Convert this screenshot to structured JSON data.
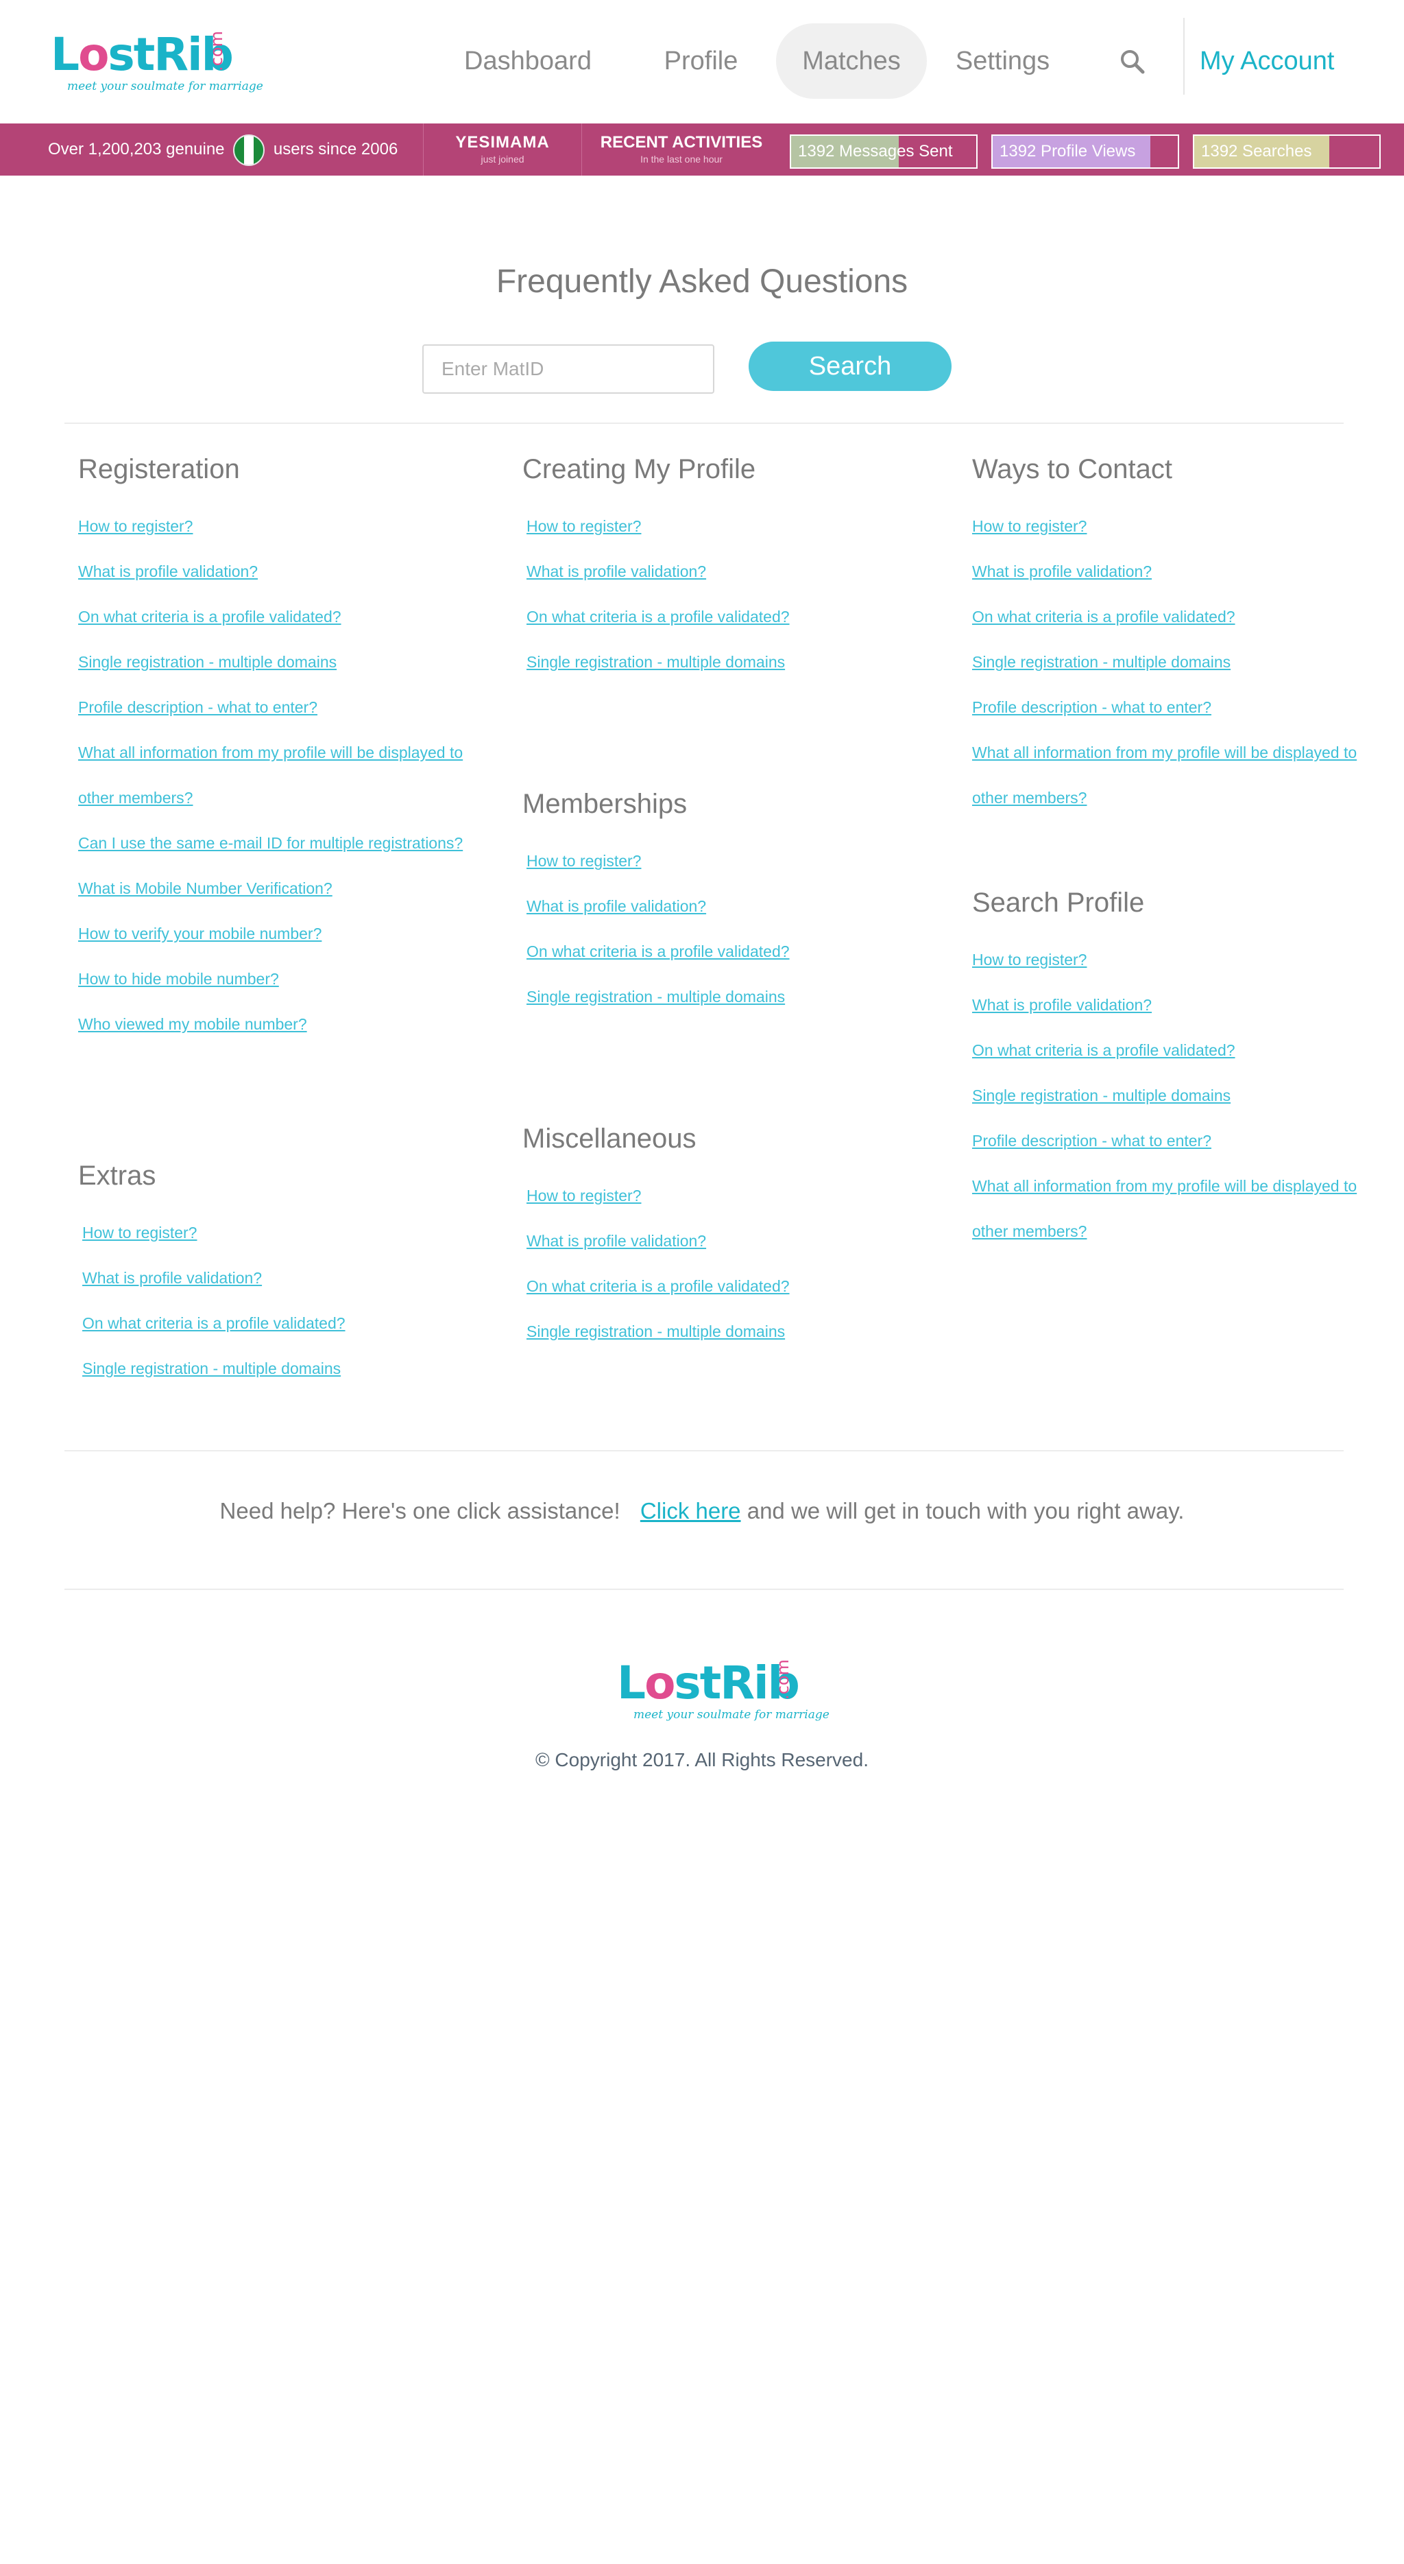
{
  "brand": {
    "name_a": "L",
    "name_ring": "o",
    "name_b": "stRib",
    "domain": ".com",
    "tagline": "meet your soulmate for marriage"
  },
  "nav": {
    "dashboard": "Dashboard",
    "profile": "Profile",
    "matches": "Matches",
    "settings": "Settings",
    "search_icon": "search-icon",
    "account": "My Account"
  },
  "stats": {
    "users_prefix": "Over 1,200,203 genuine",
    "users_suffix": "users since 2006",
    "joined_name": "YESIMAMA",
    "joined_sub": "just joined",
    "recent_title": "RECENT ACTIVITIES",
    "recent_sub": "In the last one hour",
    "messages": {
      "label": "1392 Messages Sent",
      "fill_fraction": 0.58,
      "color": "#b5c4a3"
    },
    "views": {
      "label": "1392 Profile Views",
      "fill_fraction": 0.85,
      "color": "#c7a1e0"
    },
    "searches": {
      "label": "1392 Searches",
      "fill_fraction": 0.73,
      "color": "#d7d3a0"
    }
  },
  "faq": {
    "title": "Frequently Asked Questions",
    "matid_placeholder": "Enter MatID",
    "search_button": "Search",
    "registration": {
      "title": "Registeration",
      "links": [
        "How to register?",
        "What is profile validation?",
        "On what criteria is a profile validated?",
        "Single registration - multiple domains",
        "Profile description - what to enter?",
        "What all information from my profile will be displayed to other members?",
        "Can I use the same e-mail ID for multiple registrations?",
        "What is Mobile Number Verification?",
        "How to verify your mobile number?",
        "How to hide mobile number?",
        "Who viewed my mobile number?"
      ]
    },
    "extras": {
      "title": "Extras",
      "links": [
        "How to register?",
        "What is profile validation?",
        "On what criteria is a profile validated?",
        "Single registration - multiple domains"
      ]
    },
    "creating_profile": {
      "title": "Creating My Profile",
      "links": [
        "How to register?",
        "What is profile validation?",
        "On what criteria is a profile validated?",
        "Single registration - multiple domains"
      ]
    },
    "memberships": {
      "title": "Memberships",
      "links": [
        "How to register?",
        "What is profile validation?",
        "On what criteria is a profile validated?",
        "Single registration - multiple domains"
      ]
    },
    "miscellaneous": {
      "title": "Miscellaneous",
      "links": [
        "How to register?",
        "What is profile validation?",
        "On what criteria is a profile validated?",
        "Single registration - multiple domains"
      ]
    },
    "ways_to_contact": {
      "title": "Ways to Contact",
      "links": [
        "How to register?",
        "What is profile validation?",
        "On what criteria is a profile validated?",
        "Single registration - multiple domains",
        "Profile description - what to enter?",
        "What all information from my profile will be displayed to other members?"
      ]
    },
    "search_profile": {
      "title": "Search Profile",
      "links": [
        "How to register?",
        "What is profile validation?",
        "On what criteria is a profile validated?",
        "Single registration - multiple domains",
        "Profile description - what to enter?",
        "What all information from my profile will be displayed to other members?"
      ]
    }
  },
  "help": {
    "prefix": "Need help? Here's one click assistance!",
    "link": "Click here",
    "suffix": "and we will get in touch with you right away."
  },
  "footer": {
    "copyright": "© Copyright 2017. All Rights Reserved."
  },
  "colors": {
    "accent": "#1ab3c8",
    "brand_pink": "#e04c8f",
    "stats_bar": "#b44476",
    "search_button": "#4fc7da"
  }
}
